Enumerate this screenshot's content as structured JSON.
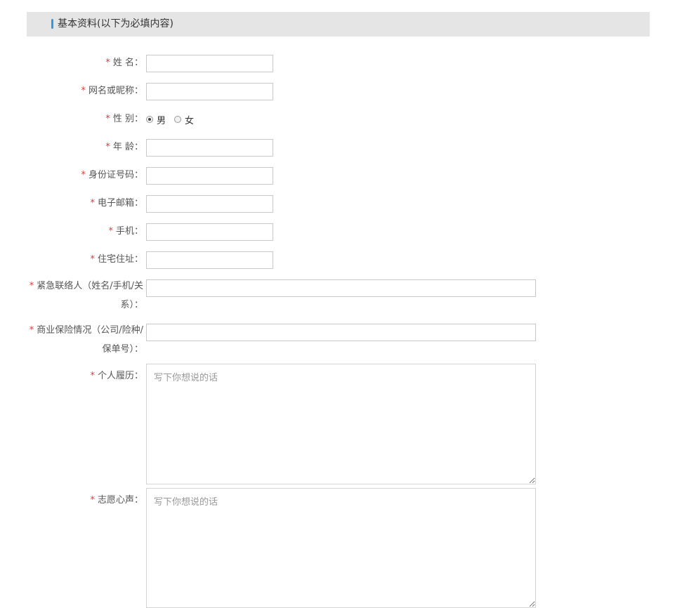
{
  "section": {
    "title": "基本资料(以下为必填内容)",
    "accent_color": "#2e9ae0",
    "background": "#e5e5e5"
  },
  "required_mark": "*",
  "fields": {
    "name": {
      "label": "姓 名：",
      "value": ""
    },
    "nickname": {
      "label": "网名或昵称：",
      "value": ""
    },
    "gender": {
      "label": "性 别：",
      "options": [
        "男",
        "女"
      ],
      "selected": "男"
    },
    "age": {
      "label": "年 龄：",
      "value": ""
    },
    "id_number": {
      "label": "身份证号码：",
      "value": ""
    },
    "email": {
      "label": "电子邮箱：",
      "value": ""
    },
    "phone": {
      "label": "手机：",
      "value": ""
    },
    "address": {
      "label": "住宅住址：",
      "value": ""
    },
    "emergency_contact": {
      "label_line1": "紧急联络人（姓名/手机/关",
      "label_line2": "系）：",
      "value": ""
    },
    "insurance": {
      "label_line1": "商业保险情况（公司/险种/",
      "label_line2": "保单号）：",
      "value": ""
    },
    "resume": {
      "label": "个人履历：",
      "placeholder": "写下你想说的话"
    },
    "aspiration": {
      "label": "志愿心声：",
      "placeholder": "写下你想说的话"
    }
  }
}
